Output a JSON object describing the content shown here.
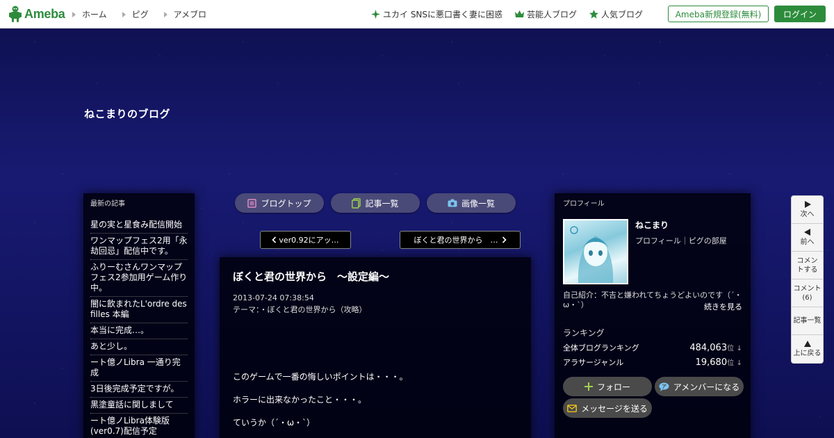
{
  "header": {
    "logo_text": "Ameba",
    "nav_left": [
      "ホーム",
      "ピグ",
      "アメブロ"
    ],
    "nav_right": [
      {
        "label": "ユカイ SNSに悪口書く妻に困惑",
        "icon": "sparkle-icon"
      },
      {
        "label": "芸能人ブログ",
        "icon": "crown-icon"
      },
      {
        "label": "人気ブログ",
        "icon": "star-icon"
      }
    ],
    "signup_label": "Ameba新規登録(無料)",
    "login_label": "ログイン"
  },
  "blog": {
    "title": "ねこまりのブログ"
  },
  "tabs": [
    {
      "label": "ブログトップ",
      "icon": "blog-top-icon"
    },
    {
      "label": "記事一覧",
      "icon": "article-list-icon"
    },
    {
      "label": "画像一覧",
      "icon": "camera-icon"
    }
  ],
  "pager": {
    "prev_label": "ver0.92にアッ…",
    "next_label": "ぼくと君の世界から　…"
  },
  "sidebar": {
    "heading": "最新の記事",
    "articles": [
      "星の実と星食み配信開始",
      "ワンマップフェス2用「永劫回忌」配信中です。",
      "ふりーむさんワンマップフェス2参加用ゲーム作り中。",
      "闇に飲まれたL'ordre des filles 本編",
      "本当に完成…。",
      "あと少し。",
      "ート億ノLibra 一通り完成",
      "3日後完成予定ですが。",
      "黒塗童話に関しまして",
      "ート億ノLibra体験版(ver0.7)配信予定"
    ]
  },
  "entry": {
    "title": "ぼくと君の世界から　～設定編～",
    "date": "2013-07-24 07:38:54",
    "theme": "テーマ：・ぼくと君の世界から（攻略）",
    "body": [
      "このゲームで一番の悔しいポイントは・・・。",
      "ホラーに出来なかったこと・・・。",
      "ていうか（´・ω・`）"
    ]
  },
  "profile": {
    "heading": "プロフィール",
    "name": "ねこまり",
    "subtitle": "プロフィール｜ピグの部屋",
    "intro": "自己紹介：不吉と嫌われてちょうどよいのです（´・ω・`）",
    "more_label": "続きを見る",
    "ranking_heading": "ランキング",
    "rankings": [
      {
        "label": "全体ブログランキング",
        "value": "484,063",
        "unit": "位",
        "arrow": "↓"
      },
      {
        "label": "アラサージャンル",
        "value": "19,680",
        "unit": "位",
        "arrow": "↓"
      }
    ],
    "follow_label": "フォロー",
    "amember_label": "アメンバーになる",
    "message_label": "メッセージを送る"
  },
  "sidenav": [
    {
      "label": "次へ",
      "icon": "play-right-icon"
    },
    {
      "label": "前へ",
      "icon": "play-left-icon"
    },
    {
      "label": "コメントする",
      "icon": ""
    },
    {
      "label": "コメント(6)",
      "icon": ""
    },
    {
      "label": "記事一覧",
      "icon": ""
    },
    {
      "label": "上に戻る",
      "icon": "up-triangle-icon"
    }
  ],
  "colors": {
    "brand_green": "#2d8c3c",
    "background": "#14145e",
    "tab_bg": "#4a4a78"
  }
}
